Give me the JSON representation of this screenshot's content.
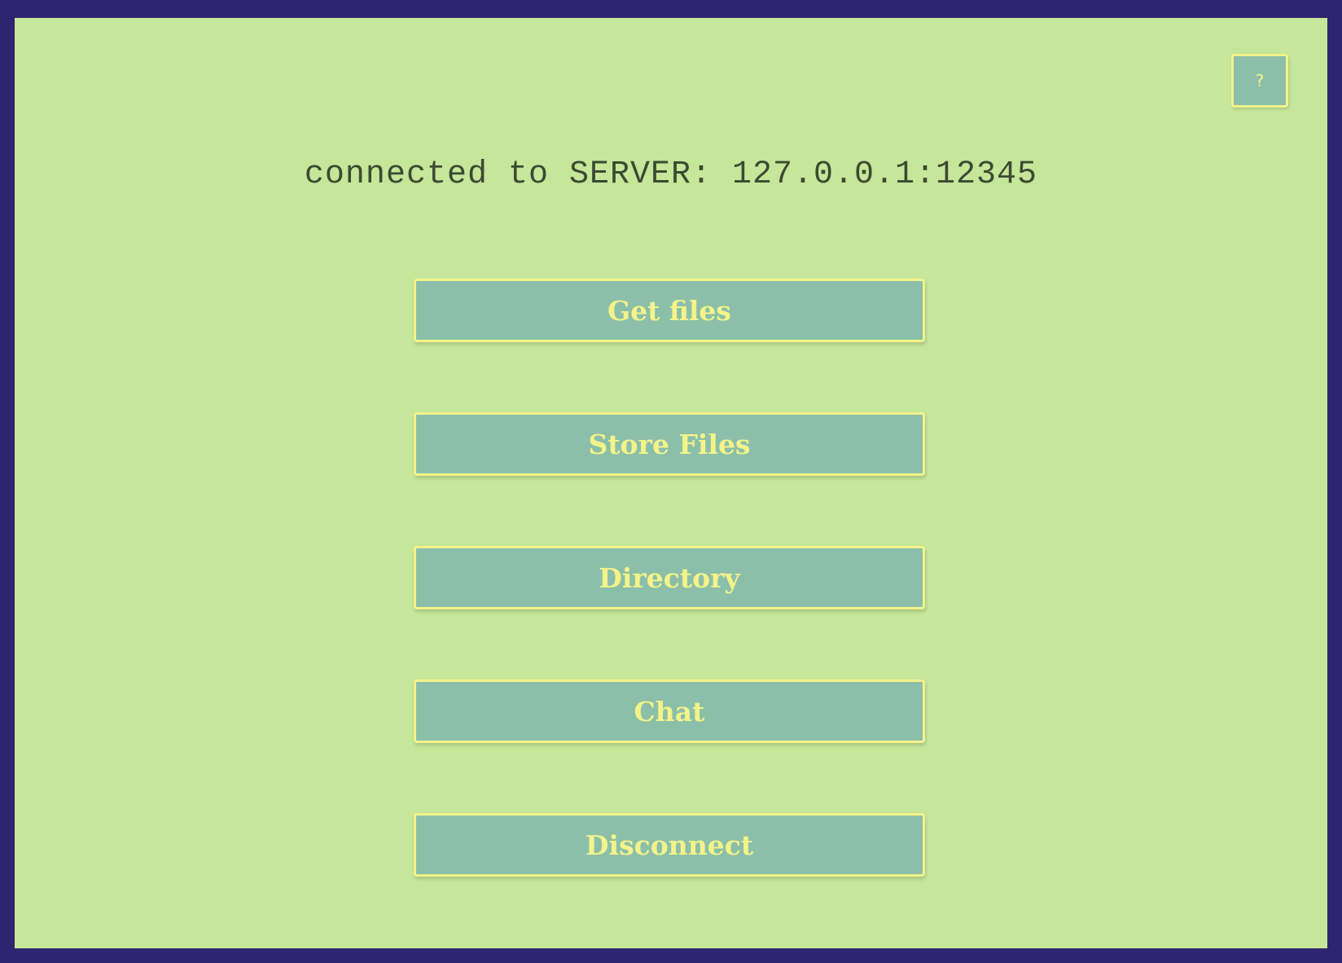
{
  "status": {
    "text": "connected to SERVER: 127.0.0.1:12345"
  },
  "help": {
    "label": "?"
  },
  "menu": {
    "get_files": "Get files",
    "store_files": "Store Files",
    "directory": "Directory",
    "chat": "Chat",
    "disconnect": "Disconnect"
  },
  "colors": {
    "frame": "#2f2470",
    "background": "#c6e699",
    "button_fill": "#8bbfa9",
    "button_accent": "#f3f389",
    "status_text": "#3c4a32"
  }
}
